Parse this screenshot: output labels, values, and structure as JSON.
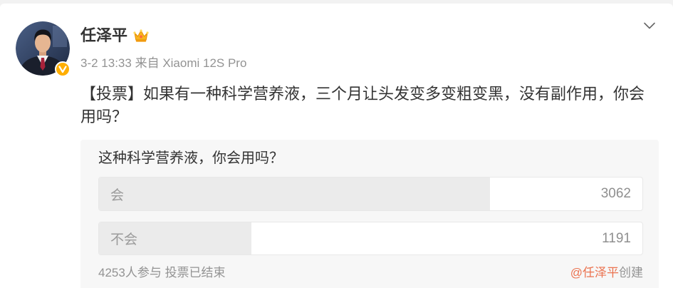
{
  "post": {
    "author": {
      "name": "任泽平",
      "avatar_icon": "author-avatar",
      "verified_icon": "verified-badge-icon",
      "member_icon": "crown-icon"
    },
    "more_icon": "chevron-down-icon",
    "meta": {
      "time": "3-2 13:33",
      "source_label": "来自",
      "source": "Xiaomi 12S Pro"
    },
    "text": "【投票】如果有一种科学营养液，三个月让头发变多变粗变黑，没有副作用，你会用吗？"
  },
  "poll": {
    "question": "这种科学营养液，你会用吗？",
    "options": [
      {
        "label": "会",
        "count": "3062",
        "share": 0.72
      },
      {
        "label": "不会",
        "count": "1191",
        "share": 0.28
      }
    ],
    "participants": "4253人参与",
    "status": "投票已结束",
    "creator": "@任泽平",
    "creator_suffix": "创建"
  },
  "colors": {
    "text": "#333333",
    "meta": "#939393",
    "link": "#eb7350",
    "poll_bg": "#f7f7f7",
    "bar_fill": "#ebebeb",
    "badge": "#ffae00"
  }
}
